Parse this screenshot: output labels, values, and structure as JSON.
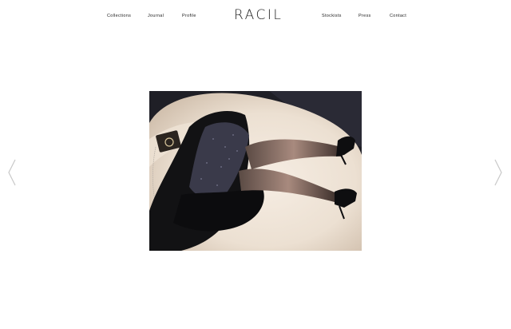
{
  "header": {
    "logo": "RACIL",
    "nav_left": [
      "Collections",
      "Journal",
      "Profile"
    ],
    "nav_right": [
      "Stockists",
      "Press",
      "Contact"
    ]
  },
  "gallery": {
    "prev_icon": "chevron-left-icon",
    "next_icon": "chevron-right-icon",
    "image": "fashion-editorial-photo"
  }
}
